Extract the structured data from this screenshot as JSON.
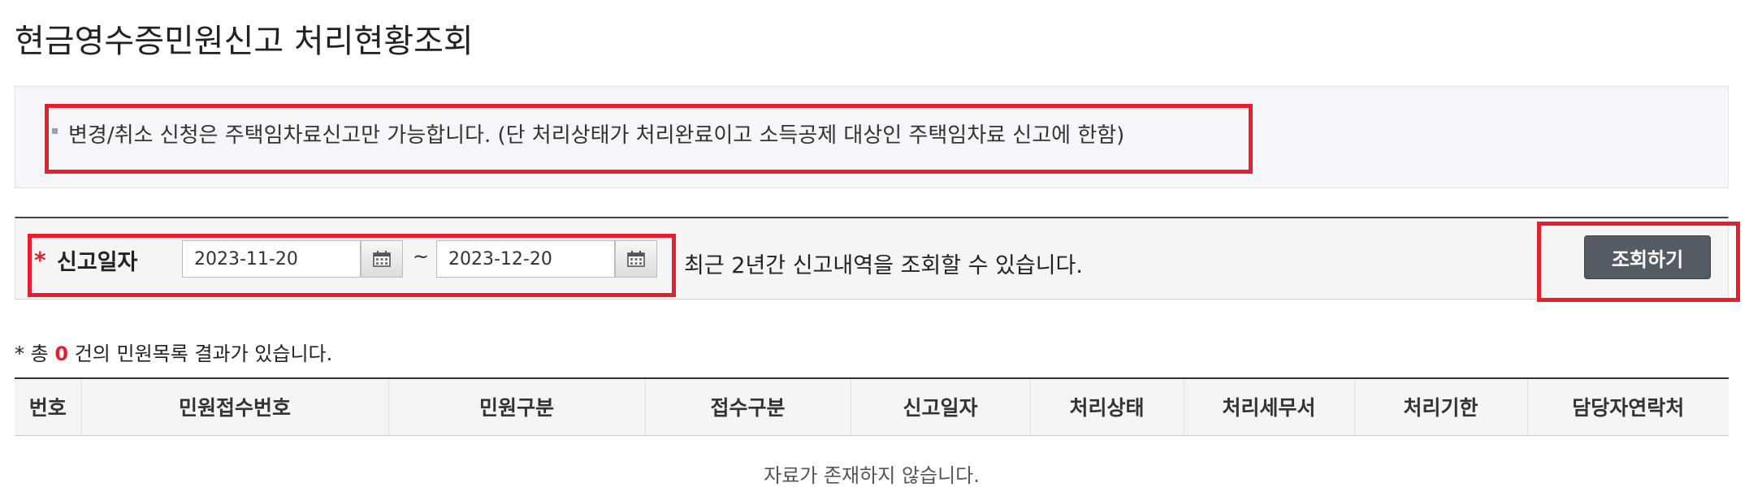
{
  "page": {
    "title": "현금영수증민원신고 처리현황조회"
  },
  "notice": {
    "text": "변경/취소 신청은 주택임차료신고만 가능합니다. (단 처리상태가 처리완료이고 소득공제 대상인 주택임차료 신고에 한함)"
  },
  "search": {
    "required_mark": "*",
    "label": "신고일자",
    "date_from": "2023-11-20",
    "separator": "~",
    "date_to": "2023-12-20",
    "hint": "최근 2년간 신고내역을 조회할 수 있습니다.",
    "button_label": "조회하기"
  },
  "results": {
    "prefix": "* 총",
    "count": "0",
    "suffix": "건의 민원목록 결과가 있습니다.",
    "columns": [
      "번호",
      "민원접수번호",
      "민원구분",
      "접수구분",
      "신고일자",
      "처리상태",
      "처리세무서",
      "처리기한",
      "담당자연락처"
    ],
    "empty_message": "자료가 존재하지 않습니다."
  },
  "colors": {
    "highlight": "#e5202e",
    "button": "#555b63",
    "count": "#e5202e"
  },
  "icons": {
    "calendar": "calendar-icon"
  }
}
